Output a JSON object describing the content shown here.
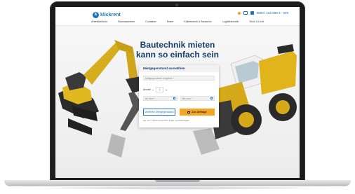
{
  "brand": {
    "name": "klickrent",
    "mark": "k"
  },
  "header": {
    "phone_text": "0800 / 162 599 3 - 599"
  },
  "nav": {
    "items": [
      "Arbeitsbühnen",
      "Baumaschinen",
      "Container",
      "Krane",
      "Kältetechnik & Baustrom",
      "Logistiktechnik",
      "Stroh & Licht"
    ]
  },
  "hero": {
    "title_line1": "Bautechnik mieten",
    "title_line2": "kann so einfach sein"
  },
  "form": {
    "heading": "Mietgegenstand auswählen",
    "item_placeholder": "Mietgegenstand eingeben *",
    "quantity_label": "Anzahl",
    "quantity_value": "1",
    "minus": "−",
    "plus": "+",
    "from_placeholder": "Ab dem *",
    "to_placeholder": "Bis zum *",
    "more_button": "Weiteren Mietgegenstand",
    "request_button": "Zur Anfrage",
    "note": "Die mit (*) gekennzeichneten Felder sind Pflichtfelder."
  },
  "colors": {
    "accent": "#1e73be",
    "cta": "#f5a623",
    "title": "#163d6b"
  }
}
